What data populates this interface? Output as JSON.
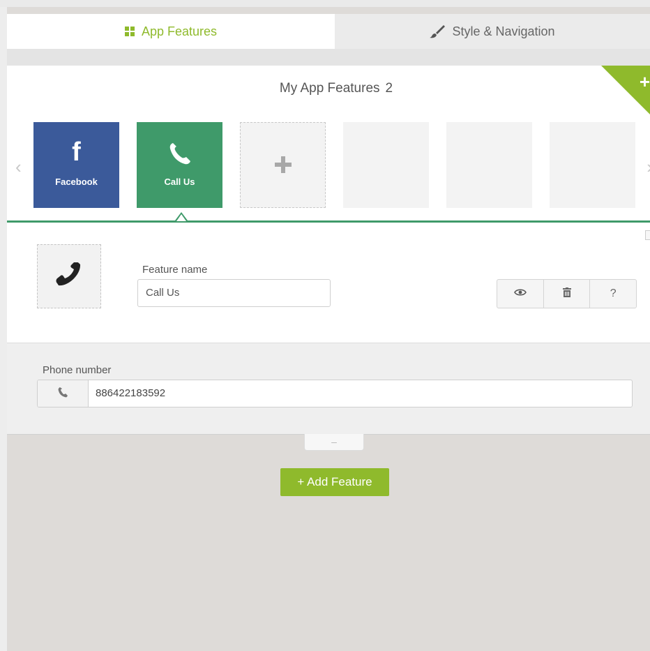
{
  "tabs": {
    "app_features": "App Features",
    "style_navigation": "Style & Navigation"
  },
  "panel": {
    "title": "My App Features",
    "count": "2",
    "corner_plus": "+"
  },
  "tiles": {
    "facebook": {
      "label": "Facebook",
      "icon": "facebook-icon"
    },
    "call_us": {
      "label": "Call Us",
      "icon": "phone-icon"
    },
    "add": {
      "icon": "plus-icon"
    }
  },
  "feature": {
    "name_label": "Feature name",
    "name_value": "Call Us",
    "icon": "phone-handset-icon",
    "actions": [
      {
        "icon": "eye-icon"
      },
      {
        "icon": "trash-icon"
      },
      {
        "label": "?"
      }
    ]
  },
  "phone": {
    "label": "Phone number",
    "value": "886422183592"
  },
  "collapse": "–",
  "add_feature_button": "+ Add Feature",
  "colors": {
    "accent_green": "#8fba2c",
    "facebook_blue": "#3b5a9a",
    "call_green": "#3f9a6a"
  }
}
